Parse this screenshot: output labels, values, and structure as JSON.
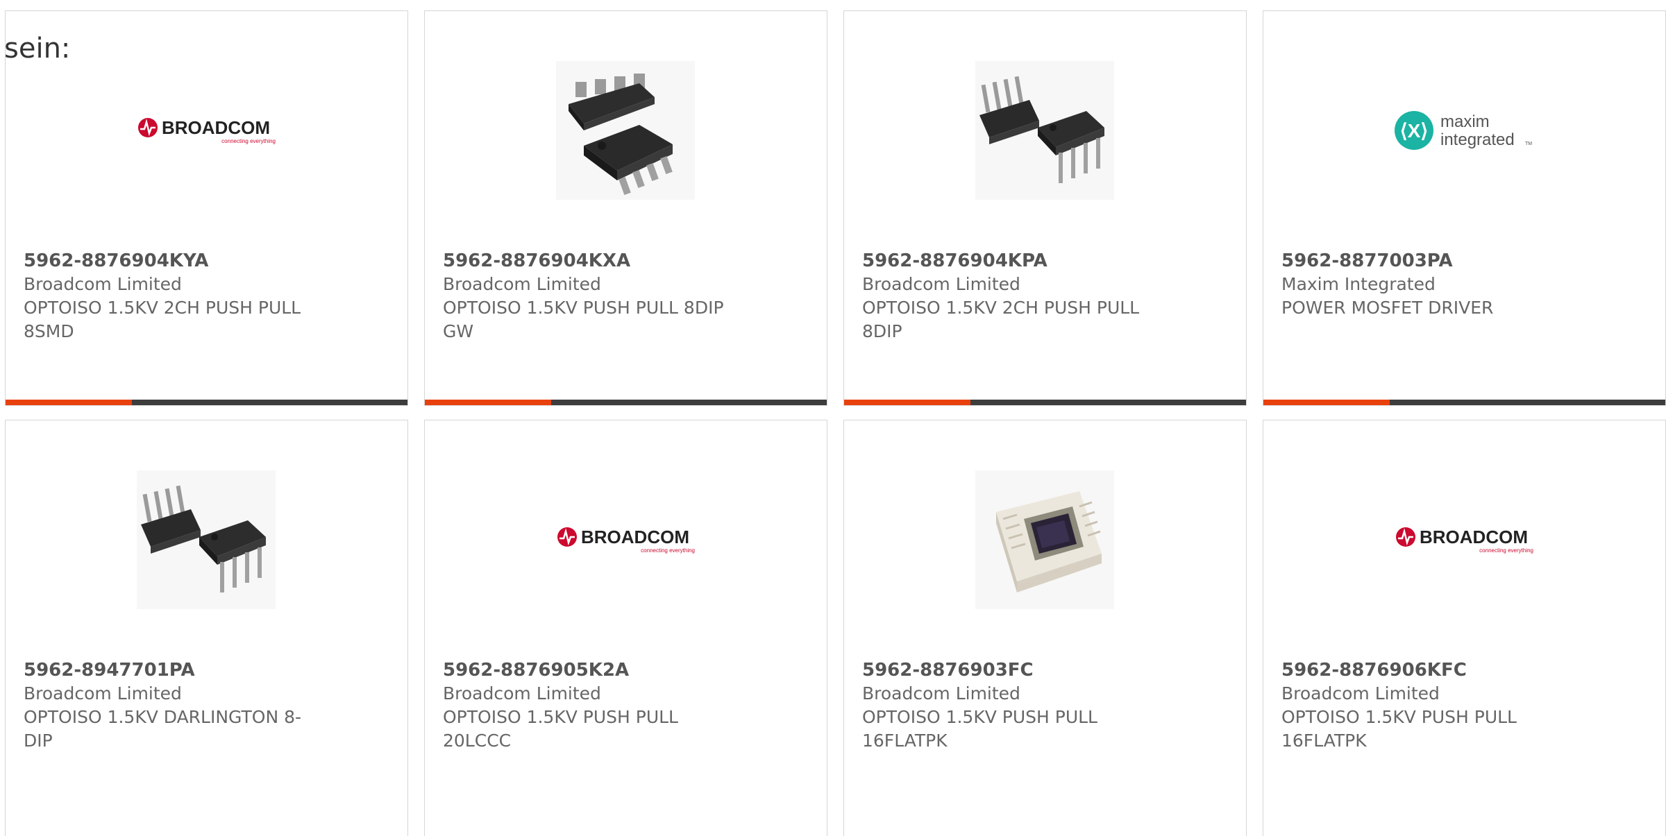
{
  "intro_text": "sein:",
  "colors": {
    "accent": "#e8410e",
    "bar": "#3d3d3d",
    "broadcom_red": "#cc092f",
    "maxim_teal": "#1bb3a3"
  },
  "logos": {
    "broadcom": {
      "name": "BROADCOM",
      "tagline": "connecting everything"
    },
    "maxim": {
      "line1": "maxim",
      "line2": "integrated",
      "tm": "TM"
    }
  },
  "products": [
    {
      "part": "5962-8876904KYA",
      "manufacturer": "Broadcom Limited",
      "description": "OPTOISO 1.5KV 2CH PUSH PULL 8SMD",
      "image": "broadcom-logo"
    },
    {
      "part": "5962-8876904KXA",
      "manufacturer": "Broadcom Limited",
      "description": "OPTOISO 1.5KV PUSH PULL 8DIP GW",
      "image": "ic-smd-package"
    },
    {
      "part": "5962-8876904KPA",
      "manufacturer": "Broadcom Limited",
      "description": "OPTOISO 1.5KV 2CH PUSH PULL 8DIP",
      "image": "ic-dip-package"
    },
    {
      "part": "5962-8877003PA",
      "manufacturer": "Maxim Integrated",
      "description": "POWER MOSFET DRIVER",
      "image": "maxim-logo"
    },
    {
      "part": "5962-8947701PA",
      "manufacturer": "Broadcom Limited",
      "description": "OPTOISO 1.5KV DARLINGTON 8-DIP",
      "image": "ic-dip-package"
    },
    {
      "part": "5962-8876905K2A",
      "manufacturer": "Broadcom Limited",
      "description": "OPTOISO 1.5KV PUSH PULL 20LCCC",
      "image": "broadcom-logo"
    },
    {
      "part": "5962-8876903FC",
      "manufacturer": "Broadcom Limited",
      "description": "OPTOISO 1.5KV PUSH PULL 16FLATPK",
      "image": "ceramic-flatpack"
    },
    {
      "part": "5962-8876906KFC",
      "manufacturer": "Broadcom Limited",
      "description": "OPTOISO 1.5KV PUSH PULL 16FLATPK",
      "image": "broadcom-logo"
    }
  ]
}
